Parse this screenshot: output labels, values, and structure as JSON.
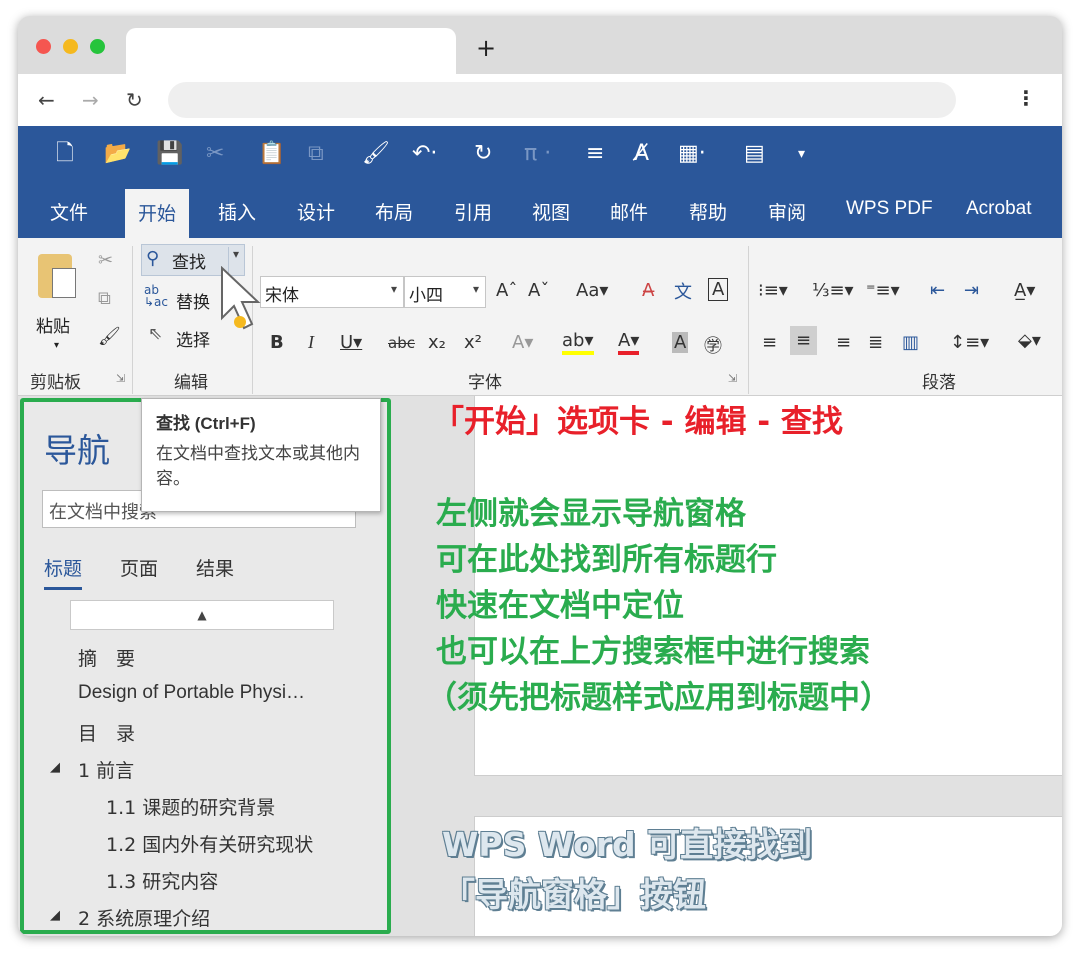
{
  "browser": {
    "new_tab_symbol": "+"
  },
  "word": {
    "menu_tabs": [
      "文件",
      "开始",
      "插入",
      "设计",
      "布局",
      "引用",
      "视图",
      "邮件",
      "帮助",
      "审阅",
      "WPS PDF",
      "Acrobat"
    ],
    "active_tab": "开始",
    "ribbon": {
      "clipboard": {
        "paste_label": "粘贴",
        "group_label": "剪贴板"
      },
      "editing": {
        "find_label": "查找",
        "replace_label": "替换",
        "select_label": "选择",
        "group_label": "编辑"
      },
      "font": {
        "font_name": "宋体",
        "font_size": "小四",
        "group_label": "字体"
      },
      "paragraph": {
        "group_label": "段落"
      }
    },
    "tooltip": {
      "title": "查找 (Ctrl+F)",
      "body": "在文档中查找文本或其他内容。"
    },
    "nav_pane": {
      "title": "导航",
      "search_placeholder": "在文档中搜索",
      "tabs": [
        "标题",
        "页面",
        "结果"
      ],
      "headings": [
        {
          "text": "摘　要",
          "level": 0
        },
        {
          "text": "Design of Portable Physi…",
          "level": 0
        },
        {
          "text": "目　录",
          "level": 0
        },
        {
          "text": "1  前言",
          "level": 0,
          "expanded": true
        },
        {
          "text": "1.1  课题的研究背景",
          "level": 1
        },
        {
          "text": "1.2  国内外有关研究现状",
          "level": 1
        },
        {
          "text": "1.3  研究内容",
          "level": 1
        },
        {
          "text": "2  系统原理介绍",
          "level": 0,
          "expanded": true
        }
      ]
    }
  },
  "annotations": {
    "red": "「开始」选项卡 - 编辑 - 查找",
    "green": [
      "左侧就会显示导航窗格",
      "可在此处找到所有标题行",
      "快速在文档中定位",
      "也可以在上方搜索框中进行搜索",
      "（须先把标题样式应用到标题中）"
    ],
    "blue": [
      "WPS Word 可直接找到",
      "「导航窗格」按钮"
    ]
  },
  "colors": {
    "word_blue": "#2b579a",
    "nav_green": "#2aac4e",
    "annotation_red": "#e8202a"
  }
}
